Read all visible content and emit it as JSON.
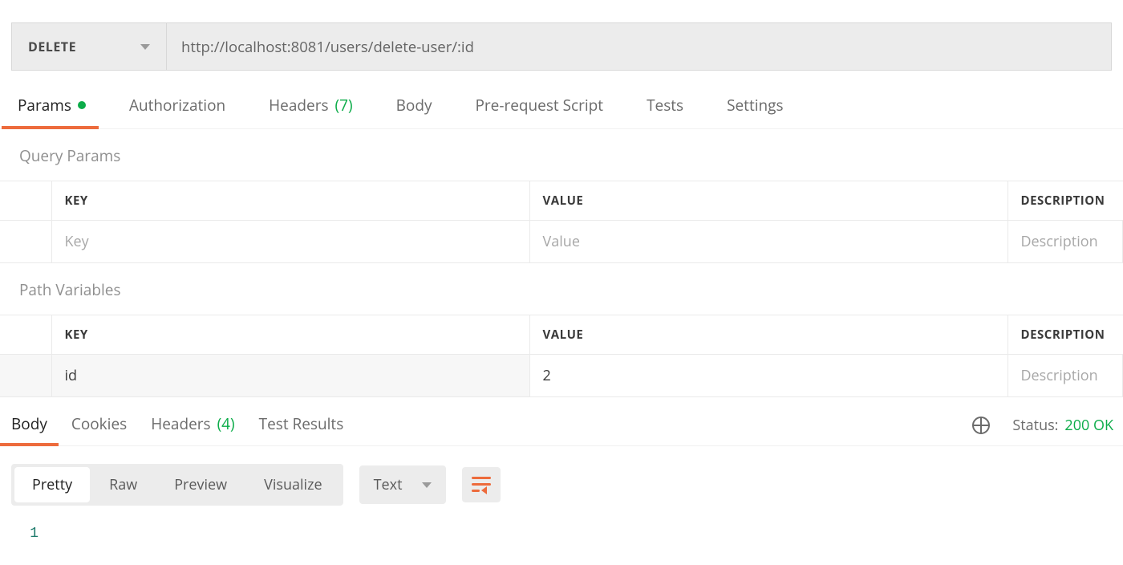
{
  "request": {
    "method": "DELETE",
    "url": "http://localhost:8081/users/delete-user/:id"
  },
  "tabs": {
    "params": {
      "label": "Params",
      "has_dot": true
    },
    "auth": {
      "label": "Authorization"
    },
    "headers": {
      "label": "Headers",
      "count": "(7)"
    },
    "body": {
      "label": "Body"
    },
    "prereq": {
      "label": "Pre-request Script"
    },
    "tests": {
      "label": "Tests"
    },
    "settings": {
      "label": "Settings"
    }
  },
  "sections": {
    "query_params_label": "Query Params",
    "path_vars_label": "Path Variables",
    "columns": {
      "key": "KEY",
      "value": "VALUE",
      "description": "DESCRIPTION"
    },
    "placeholders": {
      "key": "Key",
      "value": "Value",
      "description": "Description"
    }
  },
  "path_vars": [
    {
      "key": "id",
      "value": "2",
      "description": ""
    }
  ],
  "response": {
    "tabs": {
      "body": {
        "label": "Body"
      },
      "cookies": {
        "label": "Cookies"
      },
      "headers": {
        "label": "Headers",
        "count": "(4)"
      },
      "tests": {
        "label": "Test Results"
      }
    },
    "status_label": "Status:",
    "status_value": "200 OK",
    "view_modes": {
      "pretty": "Pretty",
      "raw": "Raw",
      "preview": "Preview",
      "visualize": "Visualize"
    },
    "content_type": "Text",
    "body_lines": [
      "1"
    ]
  }
}
